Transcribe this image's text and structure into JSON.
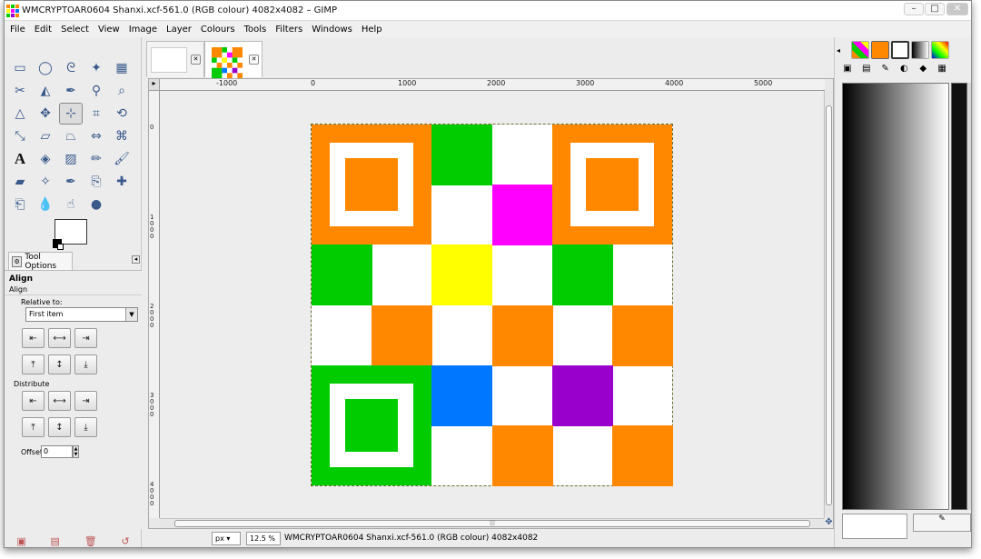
{
  "window": {
    "title": "WMCRYPTOAR0604 Shanxi.xcf-561.0 (RGB colour) 4082x4082 – GIMP",
    "controls": [
      "–",
      "□",
      "✕"
    ]
  },
  "menu": [
    "File",
    "Edit",
    "Select",
    "View",
    "Image",
    "Layer",
    "Colours",
    "Tools",
    "Filters",
    "Windows",
    "Help"
  ],
  "toolbox": {
    "tools": [
      "rect-select-icon",
      "ellipse-select-icon",
      "free-select-icon",
      "fuzzy-select-icon",
      "by-color-select-icon",
      "scissors-icon",
      "foreground-select-icon",
      "paths-icon",
      "color-picker-icon",
      "zoom-icon",
      "measure-icon",
      "move-icon",
      "align-icon",
      "crop-icon",
      "rotate-icon",
      "scale-icon",
      "shear-icon",
      "perspective-icon",
      "flip-icon",
      "cage-icon",
      "text-icon",
      "bucket-fill-icon",
      "blend-icon",
      "pencil-icon",
      "paintbrush-icon",
      "eraser-icon",
      "airbrush-icon",
      "ink-icon",
      "clone-icon",
      "heal-icon",
      "perspective-clone-icon",
      "blur-icon",
      "smudge-icon",
      "dodge-burn-icon"
    ],
    "text_tool_glyph": "A"
  },
  "tool_options": {
    "tab_label": "Tool Options",
    "title": "Align",
    "subtitle": "Align",
    "relative_label": "Relative to:",
    "relative_value": "First item",
    "distribute_label": "Distribute",
    "offset_label": "Offset:",
    "offset_value": "0"
  },
  "ruler": {
    "h_labels": [
      "-1000",
      "0",
      "1000",
      "2000",
      "3000",
      "4000",
      "5000"
    ],
    "v_labels": [
      "0",
      "1000",
      "2000",
      "3000",
      "4000"
    ]
  },
  "canvas": {
    "colors": {
      "orange": "#ff8800",
      "green": "#00cc00",
      "magenta": "#ff00ff",
      "yellow": "#ffff00",
      "blue": "#0077ff",
      "purple": "#9900cc",
      "white": "#ffffff"
    },
    "grid": [
      [
        "F",
        "F",
        "green",
        "white",
        "F",
        "F"
      ],
      [
        "F",
        "F",
        "white",
        "magenta",
        "F",
        "F"
      ],
      [
        "green",
        "white",
        "yellow",
        "white",
        "green",
        "white"
      ],
      [
        "white",
        "orange",
        "white",
        "orange",
        "white",
        "orange"
      ],
      [
        "F",
        "F",
        "blue",
        "white",
        "purple",
        "white"
      ],
      [
        "F",
        "F",
        "white",
        "orange",
        "white",
        "orange"
      ]
    ],
    "finders": [
      {
        "row": 0,
        "col": 0,
        "color": "orange"
      },
      {
        "row": 0,
        "col": 4,
        "color": "orange"
      },
      {
        "row": 4,
        "col": 0,
        "color": "green"
      }
    ]
  },
  "status": {
    "unit": "px",
    "zoom": "12.5 %",
    "text": "WMCRYPTOAR0604 Shanxi.xcf-561.0 (RGB colour) 4082x4082"
  }
}
